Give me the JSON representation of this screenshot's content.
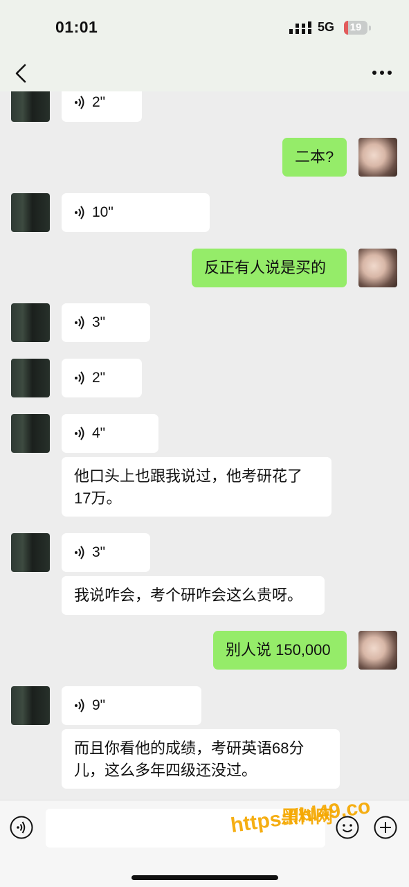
{
  "status_bar": {
    "time": "01:01",
    "network": "5G",
    "battery": "19",
    "battery_level": 0.19
  },
  "watermark": {
    "title": "黑料网",
    "url": "https://hl49.co"
  },
  "messages": [
    {
      "from": "other",
      "type": "voice",
      "duration": "2\""
    },
    {
      "from": "self",
      "type": "text",
      "text": "二本?"
    },
    {
      "from": "other",
      "type": "voice",
      "duration": "10\""
    },
    {
      "from": "self",
      "type": "text",
      "text": "反正有人说是买的"
    },
    {
      "from": "other",
      "type": "voice",
      "duration": "3\""
    },
    {
      "from": "other",
      "type": "voice",
      "duration": "2\""
    },
    {
      "from": "other",
      "type": "voice",
      "duration": "4\""
    },
    {
      "from": "other",
      "type": "text",
      "text": "他口头上也跟我说过，他考研花了17万。"
    },
    {
      "from": "other",
      "type": "voice",
      "duration": "3\""
    },
    {
      "from": "other",
      "type": "text",
      "text": "我说咋会，考个研咋会这么贵呀。"
    },
    {
      "from": "self",
      "type": "text",
      "text": "别人说 150,000"
    },
    {
      "from": "other",
      "type": "voice",
      "duration": "9\""
    },
    {
      "from": "other",
      "type": "text",
      "text": "而且你看他的成绩，考研英语68分儿，这么多年四级还没过。"
    }
  ],
  "icons": {
    "back": "chevron-left-icon",
    "more": "more-icon",
    "voice_input": "voice-input-icon",
    "emoji": "emoji-icon",
    "plus": "plus-icon"
  }
}
